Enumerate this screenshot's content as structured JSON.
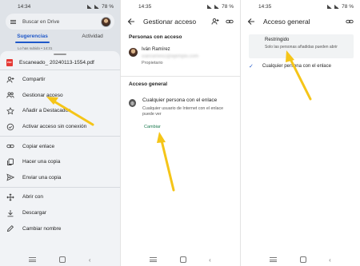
{
  "status_bar": {
    "time_left": "14:34",
    "time_mid": "14:35",
    "time_right": "14:35",
    "battery": "78 %"
  },
  "drive": {
    "search_placeholder": "Buscar en Drive",
    "tabs": [
      "Sugerencias",
      "Actividad"
    ],
    "active_tab": "Sugerencias",
    "faded_text": "Lo has subido • 14:31",
    "file_name": "Escaneado_ 20240113-1554.pdf",
    "file_icon_label": "PDF",
    "menu_group1": [
      {
        "label": "Compartir",
        "icon": "person-add-icon"
      },
      {
        "label": "Gestionar acceso",
        "icon": "people-icon"
      },
      {
        "label": "Añadir a Destacados",
        "icon": "star-icon"
      },
      {
        "label": "Activar acceso sin conexión",
        "icon": "offline-icon"
      }
    ],
    "menu_group2": [
      {
        "label": "Copiar enlace",
        "icon": "link-icon"
      },
      {
        "label": "Hacer una copia",
        "icon": "copy-icon"
      },
      {
        "label": "Enviar una copia",
        "icon": "send-icon"
      }
    ],
    "menu_group3": [
      {
        "label": "Abrir con",
        "icon": "open-with-icon"
      },
      {
        "label": "Descargar",
        "icon": "download-icon"
      },
      {
        "label": "Cambiar nombre",
        "icon": "edit-icon"
      }
    ]
  },
  "manage": {
    "title": "Gestionar acceso",
    "people_label": "Personas con acceso",
    "person_name": "Iván Ramírez",
    "person_email": "ivanramirez@ejemplo.com",
    "person_role": "Propietario",
    "general_label": "Acceso general",
    "access_title": "Cualquier persona con el enlace",
    "access_desc": "Cualquier usuario de Internet con el enlace puede ver",
    "change_label": "Cambiar"
  },
  "general": {
    "title": "Acceso general",
    "option1_title": "Restringido",
    "option1_desc": "Solo las personas añadidas pueden abrir",
    "option2_title": "Cualquier persona con el enlace",
    "check": "✓"
  },
  "colors": {
    "accent": "#1f58c9",
    "arrow": "#f5c518",
    "link_green": "#1b7a4f"
  }
}
